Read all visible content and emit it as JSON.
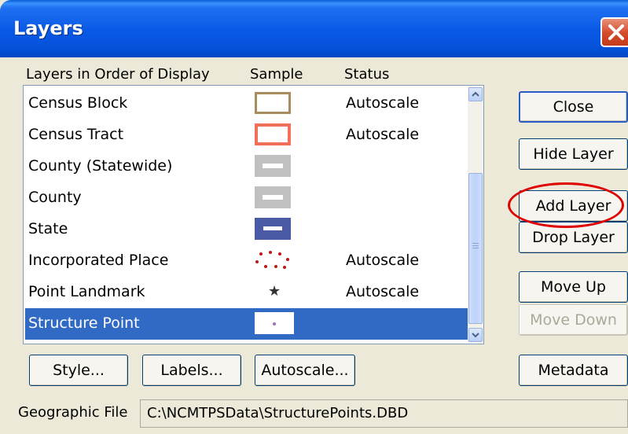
{
  "window": {
    "title": "Layers"
  },
  "columns": {
    "layers": "Layers in Order of Display",
    "sample": "Sample",
    "status": "Status"
  },
  "layers": [
    {
      "name": "Census Block",
      "status": "Autoscale",
      "sample": "hollow-rect-tan"
    },
    {
      "name": "Census Tract",
      "status": "Autoscale",
      "sample": "hollow-rect-salmon"
    },
    {
      "name": "County (Statewide)",
      "status": "",
      "sample": "hollow-rect-gray"
    },
    {
      "name": "County",
      "status": "",
      "sample": "hollow-rect-gray"
    },
    {
      "name": "State",
      "status": "",
      "sample": "filled-rect-blue"
    },
    {
      "name": "Incorporated Place",
      "status": "Autoscale",
      "sample": "red-dots"
    },
    {
      "name": "Point Landmark",
      "status": "Autoscale",
      "sample": "star"
    },
    {
      "name": "Structure Point",
      "status": "",
      "sample": "small-dot",
      "selected": true
    }
  ],
  "buttons": {
    "close": "Close",
    "hide_layer": "Hide Layer",
    "add_layer": "Add Layer",
    "drop_layer": "Drop Layer",
    "move_up": "Move Up",
    "move_down": "Move Down",
    "metadata": "Metadata",
    "style": "Style...",
    "labels": "Labels...",
    "autoscale": "Autoscale..."
  },
  "geographic_file": {
    "label": "Geographic File",
    "value": "C:\\NCMTPSData\\StructurePoints.DBD"
  },
  "colors": {
    "titlebar": "#0958e6",
    "selection": "#316ac5",
    "annotation_circle": "#e00000",
    "census_block": "#a88c5c",
    "census_tract": "#f0705a",
    "county": "#c0c0c0",
    "state": "#4a5aa5",
    "incorporated_place": "#c01818",
    "structure_point": "#a070c0"
  }
}
